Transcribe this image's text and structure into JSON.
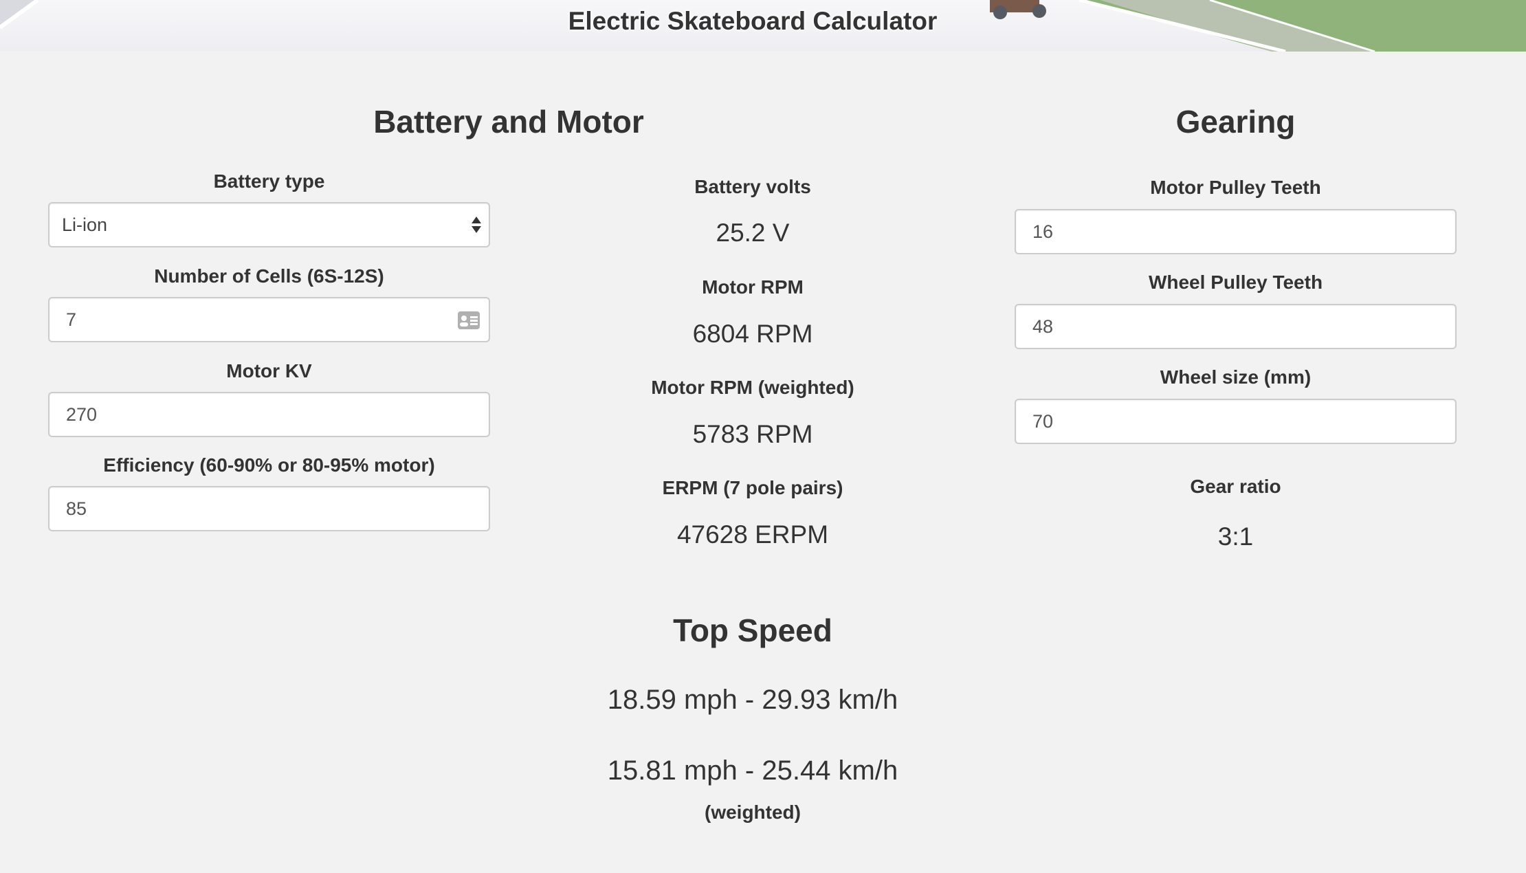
{
  "header": {
    "title": "Electric Skateboard Calculator"
  },
  "battery_motor": {
    "title": "Battery and Motor",
    "battery_type": {
      "label": "Battery type",
      "value": "Li-ion"
    },
    "cells": {
      "label": "Number of Cells (6S-12S)",
      "value": "7"
    },
    "motor_kv": {
      "label": "Motor KV",
      "value": "270"
    },
    "efficiency": {
      "label": "Efficiency (60-90% or 80-95% motor)",
      "value": "85"
    }
  },
  "results": {
    "battery_volts": {
      "label": "Battery volts",
      "value": "25.2 V"
    },
    "motor_rpm": {
      "label": "Motor RPM",
      "value": "6804 RPM"
    },
    "motor_rpm_weighted": {
      "label": "Motor RPM (weighted)",
      "value": "5783 RPM"
    },
    "erpm": {
      "label": "ERPM (7 pole pairs)",
      "value": "47628 ERPM"
    }
  },
  "gearing": {
    "title": "Gearing",
    "motor_pulley": {
      "label": "Motor Pulley Teeth",
      "value": "16"
    },
    "wheel_pulley": {
      "label": "Wheel Pulley Teeth",
      "value": "48"
    },
    "wheel_size": {
      "label": "Wheel size (mm)",
      "value": "70"
    },
    "gear_ratio": {
      "label": "Gear ratio",
      "value": "3:1"
    }
  },
  "top_speed": {
    "title": "Top Speed",
    "speed": "18.59 mph - 29.93 km/h",
    "speed_weighted": "15.81 mph - 25.44 km/h",
    "weighted_label": "(weighted)"
  }
}
